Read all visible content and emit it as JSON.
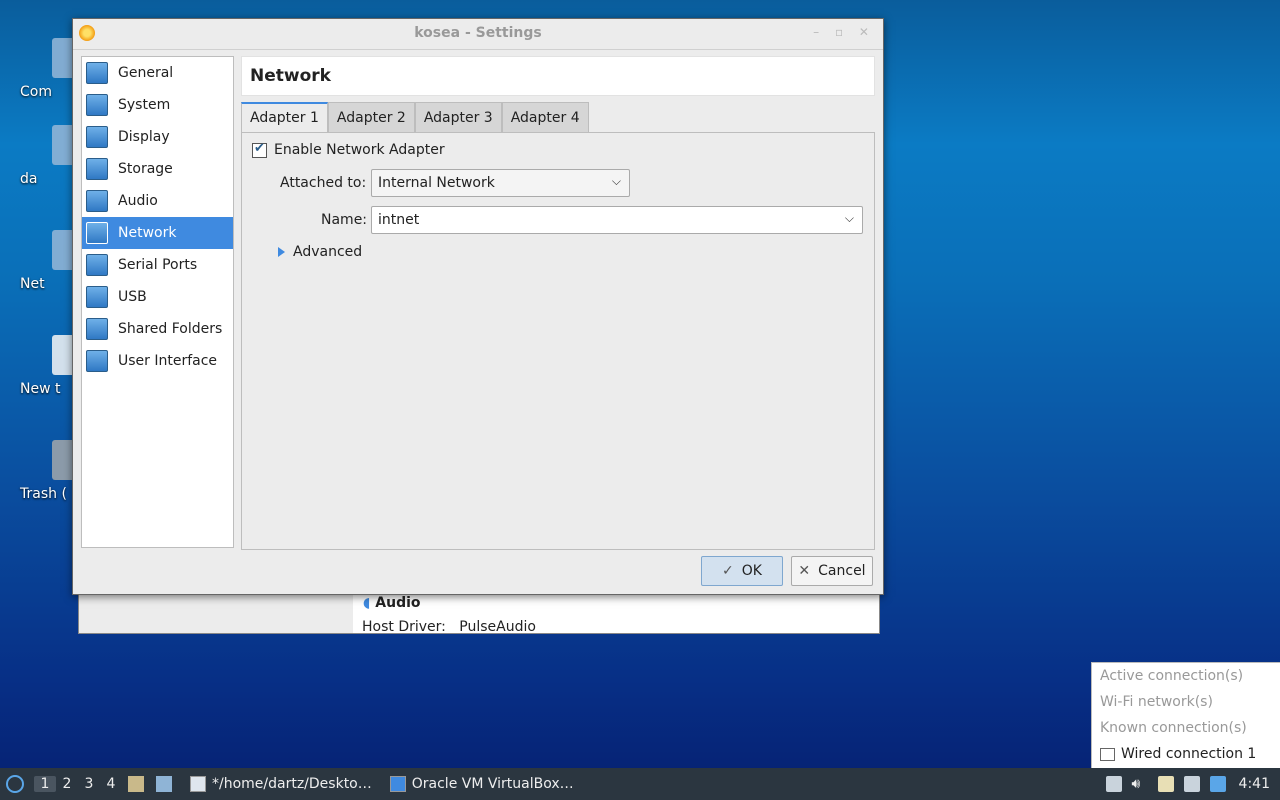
{
  "desktop": {
    "icons": [
      {
        "label": "Com",
        "name": "desktop-icon-computer"
      },
      {
        "label": "da",
        "name": "desktop-icon-home"
      },
      {
        "label": "Net",
        "name": "desktop-icon-network"
      },
      {
        "label": "New t",
        "name": "desktop-icon-new-text"
      },
      {
        "label": "Trash (",
        "name": "desktop-icon-trash"
      }
    ]
  },
  "background_window": {
    "audio_heading": "Audio",
    "host_driver_label": "Host Driver:",
    "host_driver_value": "PulseAudio"
  },
  "dialog": {
    "title": "kosea - Settings",
    "window_controls": "– ▫ ✕",
    "nav": [
      {
        "label": "General",
        "icon": "monitor-icon"
      },
      {
        "label": "System",
        "icon": "chip-icon"
      },
      {
        "label": "Display",
        "icon": "display-icon"
      },
      {
        "label": "Storage",
        "icon": "disk-icon"
      },
      {
        "label": "Audio",
        "icon": "speaker-icon"
      },
      {
        "label": "Network",
        "icon": "network-icon",
        "selected": true
      },
      {
        "label": "Serial Ports",
        "icon": "serial-port-icon"
      },
      {
        "label": "USB",
        "icon": "usb-icon"
      },
      {
        "label": "Shared Folders",
        "icon": "folder-icon"
      },
      {
        "label": "User Interface",
        "icon": "window-icon"
      }
    ],
    "section_title": "Network",
    "tabs": [
      "Adapter 1",
      "Adapter 2",
      "Adapter 3",
      "Adapter 4"
    ],
    "active_tab": "Adapter 1",
    "enable_adapter_label": "Enable Network Adapter",
    "enable_adapter_checked": true,
    "attached_to_label": "Attached to:",
    "attached_to_value": "Internal Network",
    "name_label": "Name:",
    "name_value": "intnet",
    "advanced_label": "Advanced",
    "ok_label": "OK",
    "cancel_label": "Cancel"
  },
  "network_menu": {
    "items": [
      {
        "label": "Active connection(s)",
        "active": false
      },
      {
        "label": "Wi-Fi network(s)",
        "active": false
      },
      {
        "label": "Known connection(s)",
        "active": false
      },
      {
        "label": "Wired connection 1",
        "active": true
      }
    ]
  },
  "taskbar": {
    "workspaces": [
      "1",
      "2",
      "3",
      "4"
    ],
    "current_workspace": "1",
    "tasks": [
      {
        "label": "*/home/dartz/Deskto…",
        "icon": "text-editor-icon"
      },
      {
        "label": "Oracle VM VirtualBox…",
        "icon": "virtualbox-icon"
      }
    ],
    "clock": "4:41"
  },
  "colors": {
    "selection": "#3f8ae0",
    "taskbar": "#2b3640"
  }
}
